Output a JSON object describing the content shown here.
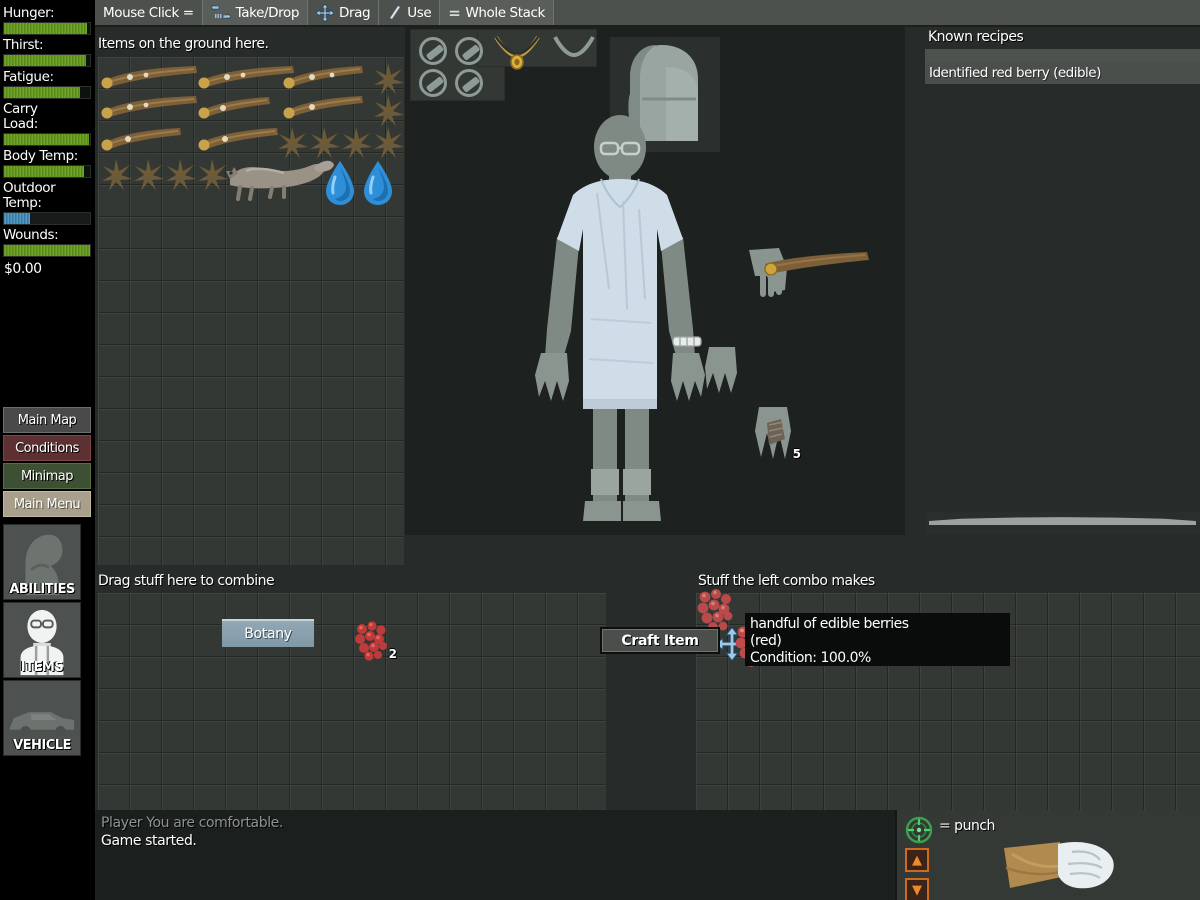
{
  "toolbar": {
    "prefix_label": "Mouse Click =",
    "items": [
      {
        "label": "Take/Drop",
        "icon": "take-drop-icon"
      },
      {
        "label": "Drag",
        "icon": "drag-arrows-icon"
      },
      {
        "label": "Use",
        "icon": "use-lightning-icon"
      },
      {
        "label": "Whole Stack",
        "icon": "equals-icon"
      }
    ]
  },
  "sidebar": {
    "stats": [
      {
        "name": "Hunger:",
        "fill_pct": 97,
        "color": "#6fa123"
      },
      {
        "name": "Thirst:",
        "fill_pct": 95,
        "color": "#6fa123"
      },
      {
        "name": "Fatigue:",
        "fill_pct": 88,
        "color": "#6fa123"
      },
      {
        "name": "Carry\nLoad:",
        "fill_pct": 99,
        "color": "#6fa123"
      },
      {
        "name": "Body Temp:",
        "fill_pct": 93,
        "color": "#6fa123"
      },
      {
        "name": "Outdoor\nTemp:",
        "fill_pct": 30,
        "color": "#3c7fae"
      },
      {
        "name": "Wounds:",
        "fill_pct": 100,
        "color": "#6fa123"
      }
    ],
    "money": "$0.00",
    "buttons": [
      {
        "label": "Main Map",
        "style": "map"
      },
      {
        "label": "Conditions",
        "style": "cond"
      },
      {
        "label": "Minimap",
        "style": "minimap"
      },
      {
        "label": "Main Menu",
        "style": "menu"
      }
    ],
    "tiles": [
      {
        "label": "ABILITIES",
        "icon": "flexed-arm-icon"
      },
      {
        "label": "ITEMS",
        "icon": "person-icon"
      },
      {
        "label": "VEHICLE",
        "icon": "car-icon"
      }
    ]
  },
  "ground": {
    "title": "Items on the ground here."
  },
  "recipes": {
    "title": "Known recipes",
    "entries": [
      "Identified red berry (edible)"
    ]
  },
  "craft": {
    "combine_title": "Drag stuff here to combine",
    "result_title": "Stuff the left combo makes",
    "button_label": "Craft Item",
    "skill_tag": "Botany",
    "input_stack_count": "2"
  },
  "tooltip": {
    "line1": "handful of edible berries",
    "line2": "(red)",
    "line3": "Condition: 100.0%"
  },
  "character": {
    "held_stack_count": "5"
  },
  "log": {
    "lines": [
      {
        "text": "Player You are comfortable.",
        "style": "old"
      },
      {
        "text": "Game started.",
        "style": "new"
      }
    ]
  },
  "weapon": {
    "label": "= punch",
    "reticle_icon": "crosshair-icon",
    "up_icon": "ammo-up-icon",
    "down_icon": "ammo-down-icon"
  },
  "colors": {
    "accent_green": "#6fa123",
    "accent_blue": "#3c7fae",
    "panel_bg": "#343835",
    "window_bg": "#272b29",
    "toolbar_bg": "#4d514e"
  }
}
